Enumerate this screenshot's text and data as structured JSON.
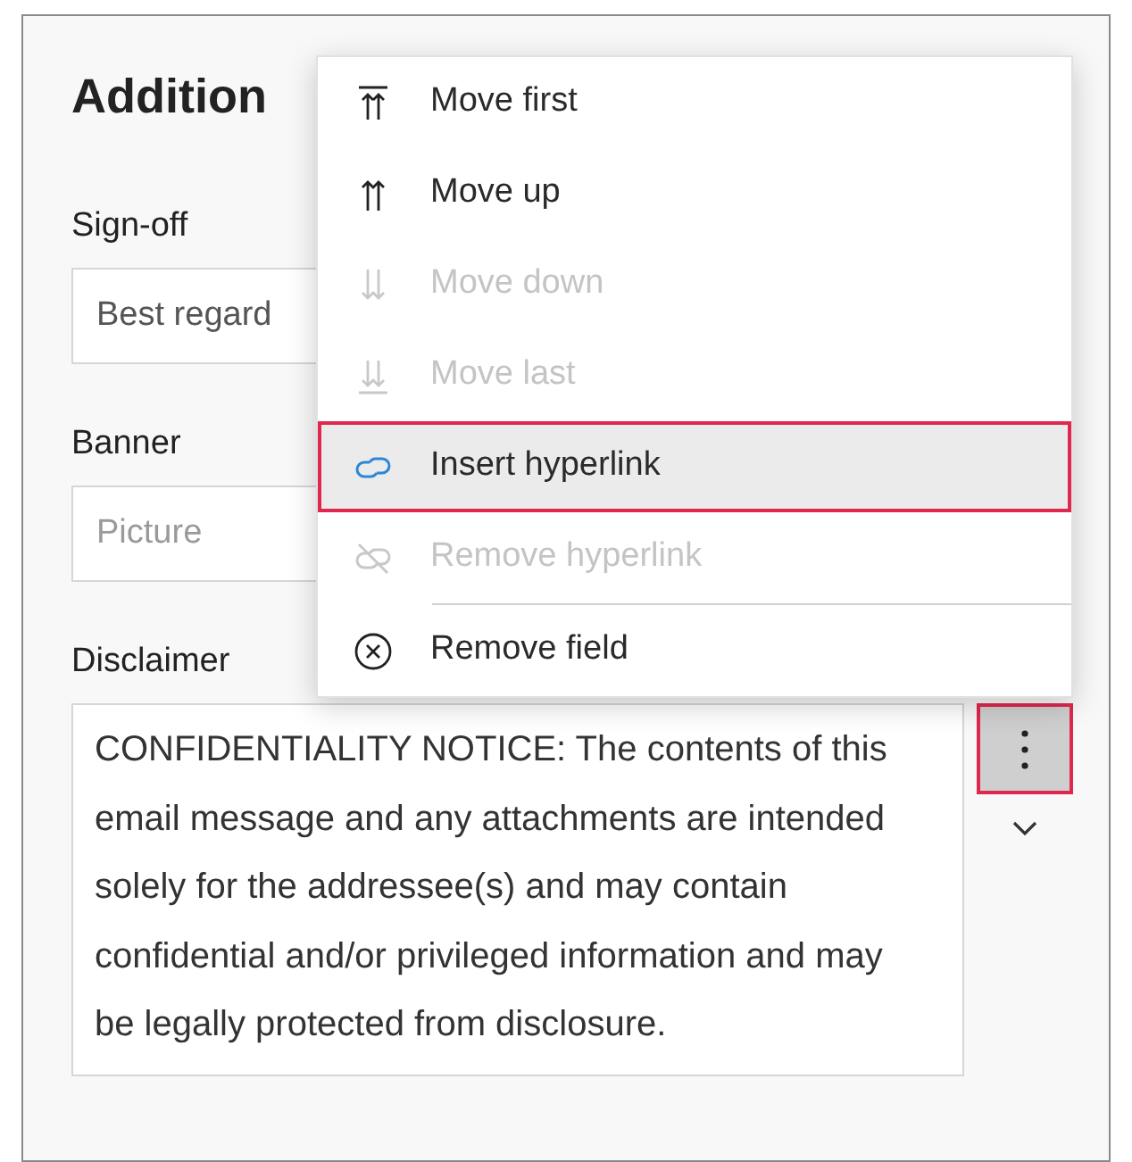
{
  "panel": {
    "heading": "Addition"
  },
  "fields": [
    {
      "label": "Sign-off",
      "kind": "input",
      "value": "Best regard"
    },
    {
      "label": "Banner",
      "kind": "input",
      "placeholder": "Picture"
    },
    {
      "label": "Disclaimer",
      "kind": "textarea",
      "value": "CONFIDENTIALITY NOTICE: The contents of this email message and any attachments are intended solely for the addressee(s) and may contain confidential and/or privileged information and may be legally protected from disclosure.",
      "more_button": {
        "highlighted": true
      }
    }
  ],
  "context_menu": {
    "items": [
      {
        "label": "Move first",
        "disabled": false,
        "highlighted": false
      },
      {
        "label": "Move up",
        "disabled": false,
        "highlighted": false
      },
      {
        "label": "Move down",
        "disabled": true,
        "highlighted": false
      },
      {
        "label": "Move last",
        "disabled": true,
        "highlighted": false
      },
      {
        "label": "Insert hyperlink",
        "disabled": false,
        "highlighted": true
      },
      {
        "label": "Remove hyperlink",
        "disabled": true,
        "highlighted": false,
        "divider_after": true
      },
      {
        "label": "Remove field",
        "disabled": false,
        "highlighted": false
      }
    ]
  }
}
